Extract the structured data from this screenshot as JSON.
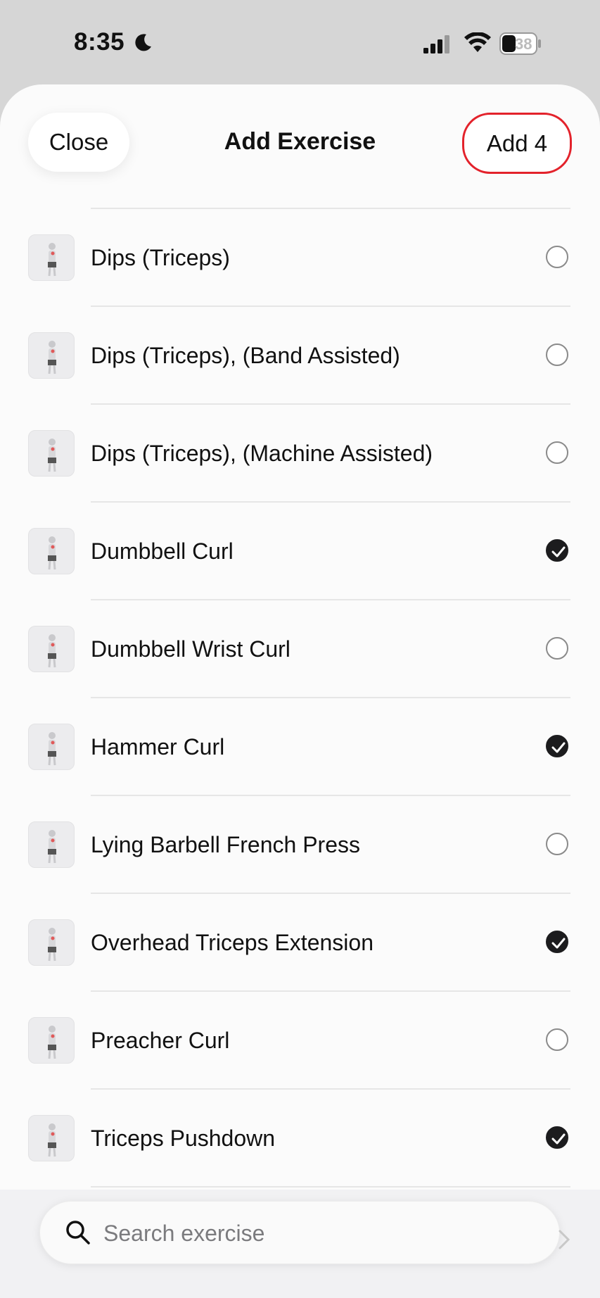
{
  "status_bar": {
    "time": "8:35",
    "battery": "38"
  },
  "header": {
    "close_label": "Close",
    "title": "Add Exercise",
    "add_label": "Add 4"
  },
  "exercises": [
    {
      "name": "Dips (Triceps)",
      "checked": false,
      "icon": "dips-thumbnail"
    },
    {
      "name": "Dips (Triceps), (Band Assisted)",
      "checked": false,
      "icon": "band-dips-thumbnail"
    },
    {
      "name": "Dips (Triceps), (Machine Assisted)",
      "checked": false,
      "icon": "machine-dips-thumbnail"
    },
    {
      "name": "Dumbbell Curl",
      "checked": true,
      "icon": "dumbbell-curl-thumbnail"
    },
    {
      "name": "Dumbbell Wrist Curl",
      "checked": false,
      "icon": "wrist-curl-thumbnail"
    },
    {
      "name": "Hammer Curl",
      "checked": true,
      "icon": "hammer-curl-thumbnail"
    },
    {
      "name": "Lying Barbell French Press",
      "checked": false,
      "icon": "french-press-thumbnail"
    },
    {
      "name": "Overhead Triceps Extension",
      "checked": true,
      "icon": "overhead-extension-thumbnail"
    },
    {
      "name": "Preacher Curl",
      "checked": false,
      "icon": "preacher-curl-thumbnail"
    },
    {
      "name": "Triceps Pushdown",
      "checked": true,
      "icon": "pushdown-thumbnail"
    }
  ],
  "search": {
    "placeholder": "Search exercise"
  },
  "colors": {
    "accent_outline": "#e3222b",
    "checked_fill": "#1c1c1e"
  }
}
